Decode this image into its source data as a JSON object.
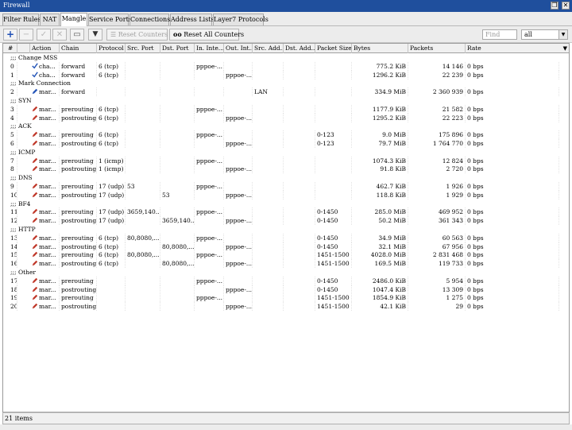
{
  "window": {
    "title": "Firewall",
    "restore_glyph": "❐",
    "close_glyph": "✕"
  },
  "tabs": [
    "Filter Rules",
    "NAT",
    "Mangle",
    "Service Ports",
    "Connections",
    "Address Lists",
    "Layer7 Protocols"
  ],
  "active_tab": "Mangle",
  "toolbar": {
    "add_icon": "+",
    "remove_icon": "−",
    "enable_icon": "✓",
    "disable_icon": "✕",
    "comment_icon": "▭",
    "filter_icon": "▼",
    "reset_counters": "Reset Counters",
    "reset_all_counters": "Reset All Counters",
    "reset_all_glyph": "oo",
    "reset_glyph": "☰",
    "find_placeholder": "Find",
    "filter_select_value": "all"
  },
  "columns": [
    "#",
    "Action",
    "Chain",
    "Protocol",
    "Src. Port",
    "Dst. Port",
    "In. Inte...",
    "Out. Int...",
    "Src. Add...",
    "Dst. Add...",
    "Packet Size",
    "Bytes",
    "Packets",
    "Rate"
  ],
  "rows": [
    {
      "type": "comment",
      "text": ";;; Change MSS"
    },
    {
      "type": "rule",
      "num": "0",
      "action": "cha...",
      "icon": "check",
      "chain": "forward",
      "protocol": "6 (tcp)",
      "src_port": "",
      "dst_port": "",
      "in_iface": "pppoe-...",
      "out_iface": "",
      "src_addr": "",
      "dst_addr": "",
      "packet_size": "",
      "bytes": "775.2 KiB",
      "packets": "14 146",
      "rate": "0 bps"
    },
    {
      "type": "rule",
      "num": "1",
      "action": "cha...",
      "icon": "check",
      "chain": "forward",
      "protocol": "6 (tcp)",
      "src_port": "",
      "dst_port": "",
      "in_iface": "",
      "out_iface": "pppoe-...",
      "src_addr": "",
      "dst_addr": "",
      "packet_size": "",
      "bytes": "1296.2 KiB",
      "packets": "22 239",
      "rate": "0 bps"
    },
    {
      "type": "comment",
      "text": ";;; Mark Connection"
    },
    {
      "type": "rule",
      "num": "2",
      "action": "mar...",
      "icon": "pencil-blue",
      "chain": "forward",
      "protocol": "",
      "src_port": "",
      "dst_port": "",
      "in_iface": "",
      "out_iface": "",
      "src_addr": "LAN",
      "dst_addr": "",
      "packet_size": "",
      "bytes": "334.9 MiB",
      "packets": "2 360 939",
      "rate": "0 bps"
    },
    {
      "type": "comment",
      "text": ";;; SYN"
    },
    {
      "type": "rule",
      "num": "3",
      "action": "mar...",
      "icon": "pencil",
      "chain": "prerouting",
      "protocol": "6 (tcp)",
      "src_port": "",
      "dst_port": "",
      "in_iface": "pppoe-...",
      "out_iface": "",
      "src_addr": "",
      "dst_addr": "",
      "packet_size": "",
      "bytes": "1177.9 KiB",
      "packets": "21 582",
      "rate": "0 bps"
    },
    {
      "type": "rule",
      "num": "4",
      "action": "mar...",
      "icon": "pencil",
      "chain": "postrouting",
      "protocol": "6 (tcp)",
      "src_port": "",
      "dst_port": "",
      "in_iface": "",
      "out_iface": "pppoe-...",
      "src_addr": "",
      "dst_addr": "",
      "packet_size": "",
      "bytes": "1295.2 KiB",
      "packets": "22 223",
      "rate": "0 bps"
    },
    {
      "type": "comment",
      "text": ";;; ACK"
    },
    {
      "type": "rule",
      "num": "5",
      "action": "mar...",
      "icon": "pencil",
      "chain": "prerouting",
      "protocol": "6 (tcp)",
      "src_port": "",
      "dst_port": "",
      "in_iface": "pppoe-...",
      "out_iface": "",
      "src_addr": "",
      "dst_addr": "",
      "packet_size": "0-123",
      "bytes": "9.0 MiB",
      "packets": "175 896",
      "rate": "0 bps"
    },
    {
      "type": "rule",
      "num": "6",
      "action": "mar...",
      "icon": "pencil",
      "chain": "postrouting",
      "protocol": "6 (tcp)",
      "src_port": "",
      "dst_port": "",
      "in_iface": "",
      "out_iface": "pppoe-...",
      "src_addr": "",
      "dst_addr": "",
      "packet_size": "0-123",
      "bytes": "79.7 MiB",
      "packets": "1 764 770",
      "rate": "0 bps"
    },
    {
      "type": "comment",
      "text": ";;; ICMP"
    },
    {
      "type": "rule",
      "num": "7",
      "action": "mar...",
      "icon": "pencil",
      "chain": "prerouting",
      "protocol": "1 (icmp)",
      "src_port": "",
      "dst_port": "",
      "in_iface": "pppoe-...",
      "out_iface": "",
      "src_addr": "",
      "dst_addr": "",
      "packet_size": "",
      "bytes": "1074.3 KiB",
      "packets": "12 824",
      "rate": "0 bps"
    },
    {
      "type": "rule",
      "num": "8",
      "action": "mar...",
      "icon": "pencil",
      "chain": "postrouting",
      "protocol": "1 (icmp)",
      "src_port": "",
      "dst_port": "",
      "in_iface": "",
      "out_iface": "pppoe-...",
      "src_addr": "",
      "dst_addr": "",
      "packet_size": "",
      "bytes": "91.8 KiB",
      "packets": "2 720",
      "rate": "0 bps"
    },
    {
      "type": "comment",
      "text": ";;; DNS"
    },
    {
      "type": "rule",
      "num": "9",
      "action": "mar...",
      "icon": "pencil",
      "chain": "prerouting",
      "protocol": "17 (udp)",
      "src_port": "53",
      "dst_port": "",
      "in_iface": "pppoe-...",
      "out_iface": "",
      "src_addr": "",
      "dst_addr": "",
      "packet_size": "",
      "bytes": "462.7 KiB",
      "packets": "1 926",
      "rate": "0 bps"
    },
    {
      "type": "rule",
      "num": "10",
      "action": "mar...",
      "icon": "pencil",
      "chain": "postrouting",
      "protocol": "17 (udp)",
      "src_port": "",
      "dst_port": "53",
      "in_iface": "",
      "out_iface": "pppoe-...",
      "src_addr": "",
      "dst_addr": "",
      "packet_size": "",
      "bytes": "118.8 KiB",
      "packets": "1 929",
      "rate": "0 bps"
    },
    {
      "type": "comment",
      "text": ";;; BF4"
    },
    {
      "type": "rule",
      "num": "11",
      "action": "mar...",
      "icon": "pencil",
      "chain": "prerouting",
      "protocol": "17 (udp)",
      "src_port": "3659,140...",
      "dst_port": "",
      "in_iface": "pppoe-...",
      "out_iface": "",
      "src_addr": "",
      "dst_addr": "",
      "packet_size": "0-1450",
      "bytes": "285.0 MiB",
      "packets": "469 952",
      "rate": "0 bps"
    },
    {
      "type": "rule",
      "num": "12",
      "action": "mar...",
      "icon": "pencil",
      "chain": "postrouting",
      "protocol": "17 (udp)",
      "src_port": "",
      "dst_port": "3659,140...",
      "in_iface": "",
      "out_iface": "pppoe-...",
      "src_addr": "",
      "dst_addr": "",
      "packet_size": "0-1450",
      "bytes": "50.2 MiB",
      "packets": "361 343",
      "rate": "0 bps"
    },
    {
      "type": "comment",
      "text": ";;; HTTP"
    },
    {
      "type": "rule",
      "num": "13",
      "action": "mar...",
      "icon": "pencil",
      "chain": "prerouting",
      "protocol": "6 (tcp)",
      "src_port": "80,8080,...",
      "dst_port": "",
      "in_iface": "pppoe-...",
      "out_iface": "",
      "src_addr": "",
      "dst_addr": "",
      "packet_size": "0-1450",
      "bytes": "34.9 MiB",
      "packets": "60 563",
      "rate": "0 bps"
    },
    {
      "type": "rule",
      "num": "14",
      "action": "mar...",
      "icon": "pencil",
      "chain": "postrouting",
      "protocol": "6 (tcp)",
      "src_port": "",
      "dst_port": "80,8080,...",
      "in_iface": "",
      "out_iface": "pppoe-...",
      "src_addr": "",
      "dst_addr": "",
      "packet_size": "0-1450",
      "bytes": "32.1 MiB",
      "packets": "67 956",
      "rate": "0 bps"
    },
    {
      "type": "rule",
      "num": "15",
      "action": "mar...",
      "icon": "pencil",
      "chain": "prerouting",
      "protocol": "6 (tcp)",
      "src_port": "80,8080,...",
      "dst_port": "",
      "in_iface": "pppoe-...",
      "out_iface": "",
      "src_addr": "",
      "dst_addr": "",
      "packet_size": "1451-1500",
      "bytes": "4028.0 MiB",
      "packets": "2 831 468",
      "rate": "0 bps"
    },
    {
      "type": "rule",
      "num": "16",
      "action": "mar...",
      "icon": "pencil",
      "chain": "postrouting",
      "protocol": "6 (tcp)",
      "src_port": "",
      "dst_port": "80,8080,...",
      "in_iface": "",
      "out_iface": "pppoe-...",
      "src_addr": "",
      "dst_addr": "",
      "packet_size": "1451-1500",
      "bytes": "169.5 MiB",
      "packets": "119 733",
      "rate": "0 bps"
    },
    {
      "type": "comment",
      "text": ";;; Other"
    },
    {
      "type": "rule",
      "num": "17",
      "action": "mar...",
      "icon": "pencil",
      "chain": "prerouting",
      "protocol": "",
      "src_port": "",
      "dst_port": "",
      "in_iface": "pppoe-...",
      "out_iface": "",
      "src_addr": "",
      "dst_addr": "",
      "packet_size": "0-1450",
      "bytes": "2486.0 KiB",
      "packets": "5 954",
      "rate": "0 bps"
    },
    {
      "type": "rule",
      "num": "18",
      "action": "mar...",
      "icon": "pencil",
      "chain": "postrouting",
      "protocol": "",
      "src_port": "",
      "dst_port": "",
      "in_iface": "",
      "out_iface": "pppoe-...",
      "src_addr": "",
      "dst_addr": "",
      "packet_size": "0-1450",
      "bytes": "1047.4 KiB",
      "packets": "13 309",
      "rate": "0 bps"
    },
    {
      "type": "rule",
      "num": "19",
      "action": "mar...",
      "icon": "pencil",
      "chain": "prerouting",
      "protocol": "",
      "src_port": "",
      "dst_port": "",
      "in_iface": "pppoe-...",
      "out_iface": "",
      "src_addr": "",
      "dst_addr": "",
      "packet_size": "1451-1500",
      "bytes": "1854.9 KiB",
      "packets": "1 275",
      "rate": "0 bps"
    },
    {
      "type": "rule",
      "num": "20",
      "action": "mar...",
      "icon": "pencil",
      "chain": "postrouting",
      "protocol": "",
      "src_port": "",
      "dst_port": "",
      "in_iface": "",
      "out_iface": "pppoe-...",
      "src_addr": "",
      "dst_addr": "",
      "packet_size": "1451-1500",
      "bytes": "42.1 KiB",
      "packets": "29",
      "rate": "0 bps"
    }
  ],
  "status": {
    "items_count": "21 items"
  },
  "colors": {
    "titlebar": "#1f4f9d",
    "add_icon": "#1f4fb5",
    "pencil_icon": "#c0392b",
    "check_icon": "#2455b8"
  }
}
